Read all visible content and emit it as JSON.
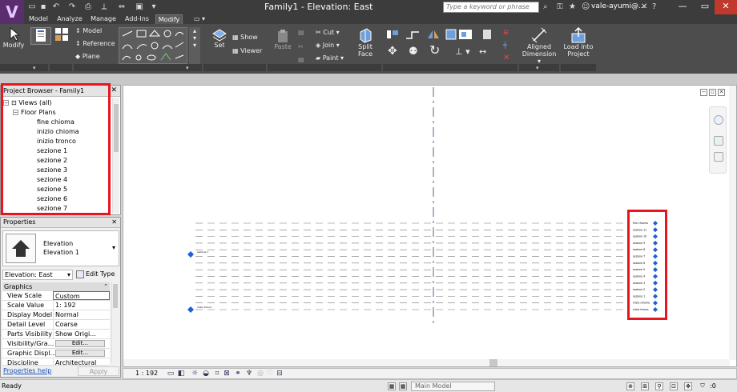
{
  "title_bar": {
    "window_title": "Family1 - Elevation: East",
    "search_placeholder": "Type a keyword or phrase",
    "user_name": "vale-ayumi@..."
  },
  "tabs": [
    {
      "label": "Model"
    },
    {
      "label": "Analyze"
    },
    {
      "label": "Manage"
    },
    {
      "label": "Add-Ins"
    },
    {
      "label": "Modify"
    }
  ],
  "ribbon": {
    "modify": "Modify",
    "model": "Model",
    "reference": "Reference",
    "plane": "Plane",
    "set": "Set",
    "show": "Show",
    "viewer": "Viewer",
    "paste": "Paste",
    "cut": "Cut",
    "join": "Join",
    "paint": "Paint",
    "split_face": "Split Face",
    "aligned_dimension_1": "Aligned",
    "aligned_dimension_2": "Dimension",
    "load_into_project_1": "Load into",
    "load_into_project_2": "Project"
  },
  "project_browser": {
    "title": "Project Browser - Family1",
    "views_all": "Views (all)",
    "floor_plans": "Floor Plans",
    "items": [
      {
        "label": "fine chioma"
      },
      {
        "label": "inizio chioma"
      },
      {
        "label": "inizio tronco"
      },
      {
        "label": "sezione 1"
      },
      {
        "label": "sezione 2"
      },
      {
        "label": "sezione 3"
      },
      {
        "label": "sezione 4"
      },
      {
        "label": "sezione 5"
      },
      {
        "label": "sezione 6"
      },
      {
        "label": "sezione 7"
      }
    ]
  },
  "properties": {
    "title": "Properties",
    "type_family": "Elevation",
    "type_name": "Elevation 1",
    "instance_selector": "Elevation: East",
    "edit_type": "Edit Type",
    "group": "Graphics",
    "rows": [
      {
        "name": "View Scale",
        "value": "Custom"
      },
      {
        "name": "Scale Value",
        "value": "1:  192"
      },
      {
        "name": "Display Model",
        "value": "Normal"
      },
      {
        "name": "Detail Level",
        "value": "Coarse"
      },
      {
        "name": "Parts Visibility",
        "value": "Show Origi..."
      },
      {
        "name": "Visibility/Gra...",
        "value": "Edit..."
      },
      {
        "name": "Graphic Displ...",
        "value": "Edit..."
      },
      {
        "name": "Discipline",
        "value": "Architectural"
      }
    ],
    "help_link": "Properties help",
    "apply": "Apply"
  },
  "canvas": {
    "level_labels": [
      "fine chioma",
      "sezione 11",
      "sezione 10",
      "sezione 9",
      "sezione 8",
      "sezione 7",
      "sezione 6",
      "sezione 5",
      "sezione 4",
      "sezione 3",
      "sezione 2",
      "sezione 1",
      "inizio chioma",
      "inizio tronco"
    ],
    "left_label_1": "sezione 7",
    "left_label_2": "inizio tronco"
  },
  "view_control": {
    "scale": "1 : 192"
  },
  "status_bar": {
    "status": "Ready",
    "model": "Main Model",
    "filter_count": ":0"
  }
}
